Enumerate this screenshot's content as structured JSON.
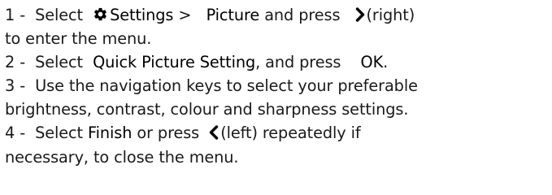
{
  "steps": [
    {
      "number": "1 -",
      "select": "Select",
      "settings": "Settings",
      "sep": ">",
      "picture": "Picture",
      "and_press": "and press",
      "key_label": "(right)",
      "continuation": "to enter the menu."
    },
    {
      "number": "2 -",
      "select": "Select",
      "item": "Quick Picture Setting",
      "and_press": ", and press",
      "key": "OK",
      "end": "."
    },
    {
      "number": "3 -",
      "text": "Use the navigation keys to select your preferable",
      "continuation": "brightness, contrast, colour and sharpness settings."
    },
    {
      "number": "4 -",
      "select": "Select",
      "item": "Finish",
      "or_press": "or press",
      "key_label": "(left) repeatedly if",
      "continuation": "necessary, to close the menu."
    }
  ],
  "icons": {
    "settings": "gear-icon",
    "right": "chevron-right-icon",
    "left": "chevron-left-icon"
  }
}
